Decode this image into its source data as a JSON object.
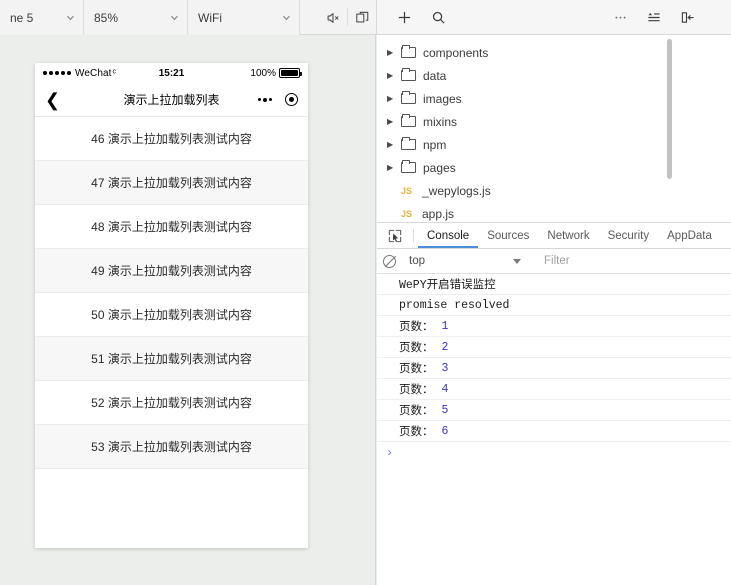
{
  "toolbar": {
    "device_select": {
      "value": "ne 5",
      "icon": "chevron-down-icon"
    },
    "scale_select": {
      "value": "85%",
      "icon": "chevron-down-icon"
    },
    "network_select": {
      "value": "WiFi",
      "icon": "chevron-down-icon"
    },
    "mute_icon": "speaker-mute-icon",
    "window_icon": "multi-window-icon",
    "add_icon": "plus-icon",
    "search_icon": "search-icon",
    "more_icon": "ellipsis-icon",
    "layout_icon": "align-list-icon",
    "collapse_icon": "panel-collapse-right-icon"
  },
  "simulator": {
    "status_bar": {
      "carrier": "WeChat",
      "wifi_glyph": "ᶜ",
      "time": "15:21",
      "battery_percent": "100%"
    },
    "nav": {
      "back_icon": "back-chevron-icon",
      "title": "演示上拉加载列表",
      "more_icon": "capsule-more-icon",
      "target_icon": "capsule-target-icon"
    },
    "list_items": [
      "46 演示上拉加载列表测试内容",
      "47 演示上拉加载列表测试内容",
      "48 演示上拉加载列表测试内容",
      "49 演示上拉加载列表测试内容",
      "50 演示上拉加载列表测试内容",
      "51 演示上拉加载列表测试内容",
      "52 演示上拉加载列表测试内容",
      "53 演示上拉加载列表测试内容"
    ]
  },
  "file_tree": [
    {
      "type": "folder",
      "label": "components",
      "arrow": "▶"
    },
    {
      "type": "folder",
      "label": "data",
      "arrow": "▶"
    },
    {
      "type": "folder",
      "label": "images",
      "arrow": "▶"
    },
    {
      "type": "folder",
      "label": "mixins",
      "arrow": "▶"
    },
    {
      "type": "folder",
      "label": "npm",
      "arrow": "▶"
    },
    {
      "type": "folder",
      "label": "pages",
      "arrow": "▶"
    },
    {
      "type": "js",
      "label": "_wepylogs.js",
      "badge": "JS"
    },
    {
      "type": "js",
      "label": "app.js",
      "badge": "JS"
    }
  ],
  "devtools": {
    "inspect_icon": "inspect-element-icon",
    "tabs": [
      {
        "label": "Console",
        "active": true
      },
      {
        "label": "Sources",
        "active": false
      },
      {
        "label": "Network",
        "active": false
      },
      {
        "label": "Security",
        "active": false
      },
      {
        "label": "AppData",
        "active": false
      }
    ],
    "clear_icon": "clear-console-icon",
    "context_value": "top",
    "filter_placeholder": "Filter",
    "filter_value": "",
    "prompt_glyph": "›",
    "console_rows": [
      {
        "text": "WePY开启错误监控",
        "num": ""
      },
      {
        "text": "promise resolved",
        "num": ""
      },
      {
        "text": "页数：",
        "num": "1"
      },
      {
        "text": "页数：",
        "num": "2"
      },
      {
        "text": "页数：",
        "num": "3"
      },
      {
        "text": "页数：",
        "num": "4"
      },
      {
        "text": "页数：",
        "num": "5"
      },
      {
        "text": "页数：",
        "num": "6"
      }
    ]
  },
  "colors": {
    "accent": "#4a90d9",
    "number": "#3b35c4",
    "js_badge": "#e8b339"
  }
}
